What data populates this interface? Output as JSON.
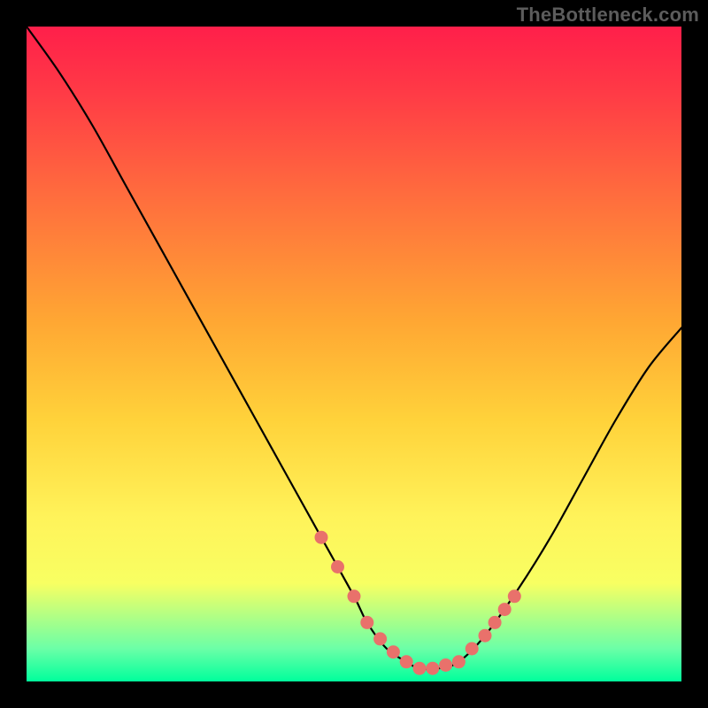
{
  "watermark": "TheBottleneck.com",
  "chart_data": {
    "type": "line",
    "title": "",
    "xlabel": "",
    "ylabel": "",
    "xlim": [
      0,
      100
    ],
    "ylim": [
      0,
      100
    ],
    "grid": false,
    "legend": false,
    "series": [
      {
        "name": "bottleneck-curve",
        "x": [
          0,
          5,
          10,
          15,
          20,
          25,
          30,
          35,
          40,
          45,
          50,
          52,
          55,
          58,
          60,
          63,
          66,
          70,
          75,
          80,
          85,
          90,
          95,
          100
        ],
        "y": [
          100,
          93,
          85,
          76,
          67,
          58,
          49,
          40,
          31,
          22,
          13,
          9,
          5,
          3,
          2,
          2,
          3,
          7,
          14,
          22,
          31,
          40,
          48,
          54
        ]
      }
    ],
    "highlight_points": {
      "name": "sweet-spot-markers",
      "x": [
        45,
        47.5,
        50,
        52,
        54,
        56,
        58,
        60,
        62,
        64,
        66,
        68,
        70,
        71.5,
        73,
        74.5
      ],
      "y": [
        22,
        17.5,
        13,
        9,
        6.5,
        4.5,
        3,
        2,
        2,
        2.5,
        3,
        5,
        7,
        9,
        11,
        13
      ]
    }
  }
}
